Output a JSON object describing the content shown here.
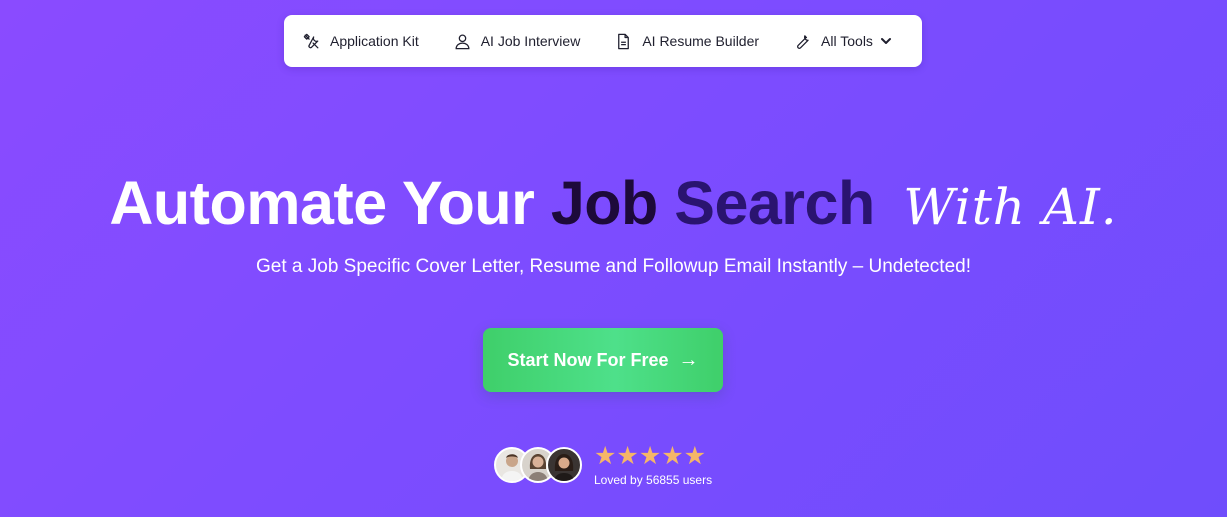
{
  "nav": {
    "items": [
      {
        "label": "Application Kit",
        "icon": "tools-icon"
      },
      {
        "label": "AI Job Interview",
        "icon": "user-icon"
      },
      {
        "label": "AI Resume Builder",
        "icon": "document-icon"
      },
      {
        "label": "All Tools",
        "icon": "wrench-icon"
      }
    ]
  },
  "hero": {
    "headline_part1": "Automate Your",
    "headline_part2": "Job",
    "headline_part3": "Search",
    "headline_script": "With AI.",
    "subtitle": "Get a Job Specific Cover Letter, Resume and Followup Email Instantly – Undetected!",
    "cta_label": "Start Now For Free",
    "cta_arrow": "→"
  },
  "social_proof": {
    "stars": "★★★★★",
    "rating": 5,
    "loved_text": "Loved by 56855 users"
  },
  "colors": {
    "background_start": "#8a4bff",
    "background_end": "#6f4dfc",
    "cta": "#45d678",
    "headline_dark": "#1d0a3a",
    "star": "#f5b668"
  }
}
